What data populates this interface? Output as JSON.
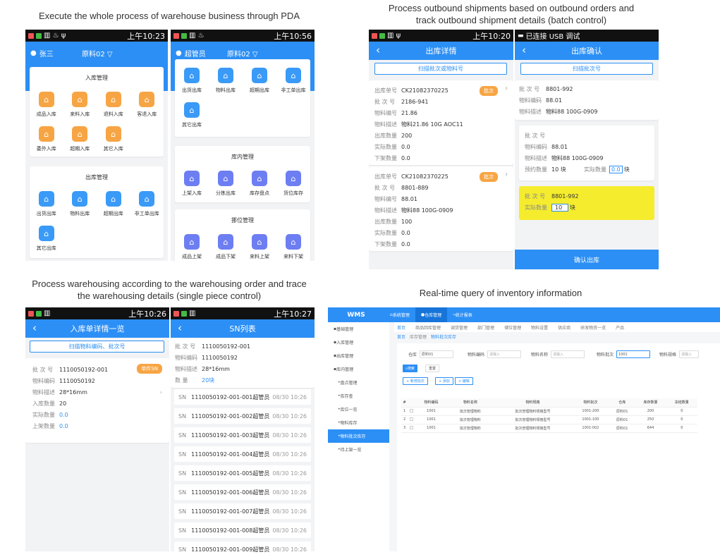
{
  "captions": {
    "top_left": "Execute the whole process of warehouse business through PDA",
    "top_right": "Process outbound shipments based on outbound orders and track outbound shipment details (batch control)",
    "bottom_left": "Process warehousing according to the warehousing order and trace the warehousing details (single piece control)",
    "bottom_right": "Real-time query of inventory information"
  },
  "status_times": [
    "上午10:23",
    "上午10:56",
    "上午10:20",
    "上午10:26",
    "上午10:27"
  ],
  "usb_status": "已连接 USB 调试",
  "home1": {
    "user": "张三",
    "org": "原料02 ▽",
    "inbound_title": "入库管理",
    "inbound_items": [
      "成品入库",
      "来料入库",
      "退料入库",
      "客退入库",
      "委外入库",
      "超期入库",
      "其它入库"
    ],
    "outbound_title": "出库管理",
    "outbound_items": [
      "出货出库",
      "物料出库",
      "超期出库",
      "非工单出库",
      "其它出库"
    ]
  },
  "home2": {
    "user": "超管员",
    "org": "原料02 ▽",
    "out_items": [
      "出货出库",
      "物料出库",
      "超期出库",
      "非工单出库",
      "其它出库"
    ],
    "inwh_title": "库内管理",
    "inwh_items": [
      "上架入库",
      "分拣出库",
      "库存盘点",
      "货位库存"
    ],
    "move_title": "挪位管理",
    "move_items": [
      "成品上架",
      "成品下架",
      "来料上架",
      "来料下架"
    ]
  },
  "outbound_detail": {
    "title": "出库详情",
    "scan": "扫描批次或物料号",
    "badge": "批次",
    "orders": [
      {
        "order_no": "CK21082370225",
        "batch": "2186-941",
        "code": "21.86",
        "desc": "物料21.86 10G AOC11",
        "qty_out": "200",
        "actual": "0.0",
        "unshelved": "0.0"
      },
      {
        "order_no": "CK21082370225",
        "batch": "8801-889",
        "code": "88.01",
        "desc": "物料88 100G-0909",
        "qty_out": "100",
        "actual": "0.0",
        "unshelved": "0.0"
      }
    ],
    "labels": {
      "order_no": "出库单号",
      "batch": "批 次 号",
      "code": "物料编号",
      "desc": "物料描述",
      "qty_out": "出库数量",
      "actual": "实际数量",
      "unshelved": "下架数量"
    }
  },
  "outbound_confirm": {
    "title": "出库确认",
    "scan": "扫描批次号",
    "batch_label": "批 次 号",
    "batch": "8801-992",
    "code_label": "物料编码",
    "code": "88.01",
    "desc_label": "物料描述",
    "desc": "物料88 100G-0909",
    "reserve_label": "预约数量",
    "reserve": "10 块",
    "actual_label": "实际数量",
    "actual_value": "0.0",
    "unit": "块",
    "hl_batch": "8801-992",
    "hl_actual": "10",
    "confirm": "确认出库"
  },
  "inbound_list": {
    "title": "入库单详情一览",
    "scan": "扫描物料编码、批次号",
    "badge": "单件SN",
    "batch_label": "批 次 号",
    "batch": "1110050192-001",
    "code_label": "物料编码",
    "code": "1110050192",
    "desc_label": "物料描述",
    "desc": "28*16mm",
    "qty_in_label": "入库数量",
    "qty_in": "20",
    "actual_label": "实际数量",
    "actual": "0.0",
    "shelf_label": "上架数量",
    "shelf": "0.0"
  },
  "sn_list": {
    "title": "SN列表",
    "batch_label": "批 次 号",
    "batch": "1110050192-001",
    "code_label": "物料编码",
    "code": "1110050192",
    "desc_label": "物料描述",
    "desc": "28*16mm",
    "qty_label": "数    量",
    "qty": "20块",
    "sn_key": "SN",
    "items": [
      {
        "sn": "1110050192-001-001超管员",
        "time": "08/30 10:26"
      },
      {
        "sn": "1110050192-001-002超管员",
        "time": "08/30 10:26"
      },
      {
        "sn": "1110050192-001-003超管员",
        "time": "08/30 10:26"
      },
      {
        "sn": "1110050192-001-004超管员",
        "time": "08/30 10:26"
      },
      {
        "sn": "1110050192-001-005超管员",
        "time": "08/30 10:26"
      },
      {
        "sn": "1110050192-001-006超管员",
        "time": "08/30 10:26"
      },
      {
        "sn": "1110050192-001-007超管员",
        "time": "08/30 10:26"
      },
      {
        "sn": "1110050192-001-008超管员",
        "time": "08/30 10:26"
      },
      {
        "sn": "1110050192-001-009超管员",
        "time": "08/30 10:26"
      }
    ]
  },
  "wms": {
    "logo": "WMS",
    "menus": [
      "系统管理",
      "仓库管理",
      "统计报表"
    ],
    "side": [
      "基础管理",
      "入库管理",
      "出库管理",
      "库内管理",
      "盘点管理",
      "库存查",
      "库位一览",
      "物料库存",
      "物料批次库存",
      "待上架一览"
    ],
    "tabs": [
      "首页",
      "商品回库管理",
      "调货管理",
      "部门管理",
      "储位管理",
      "物料设置",
      "供应商",
      "研发物资一览",
      "产品"
    ],
    "breadcrumb": [
      "首页",
      "库存管理",
      "物料批次库存"
    ],
    "filters": {
      "wh_label": "仓库",
      "wh_value": "原料01",
      "code_label": "物料编码",
      "code_ph": "请输入",
      "name_label": "物料名称",
      "name_ph": "请输入",
      "batch_label": "物料批次",
      "batch_value": "1001",
      "spec_label": "物料规格",
      "spec_ph": "请输入"
    },
    "buttons": {
      "search": "搜索",
      "reset": "重置",
      "new_batch": "+ 新增批次",
      "add": "+ 添加",
      "edit": "+ 编辑"
    },
    "columns": [
      "#",
      "",
      "物料编码",
      "物料名称",
      "物料规格",
      "物料批次",
      "仓库",
      "库存数量",
      "冻结数量"
    ],
    "rows": [
      [
        "1",
        "",
        "1001",
        "批次管理物料",
        "批次管理物料规格型号",
        "1001-200",
        "原料01",
        "200",
        "0"
      ],
      [
        "2",
        "",
        "1001",
        "批次管理物料",
        "批次管理物料规格型号",
        "1001-100",
        "原料01",
        "250",
        "0"
      ],
      [
        "3",
        "",
        "1001",
        "批次管理物料",
        "批次管理物料规格型号",
        "1001-002",
        "原料01",
        "644",
        "0"
      ]
    ]
  }
}
